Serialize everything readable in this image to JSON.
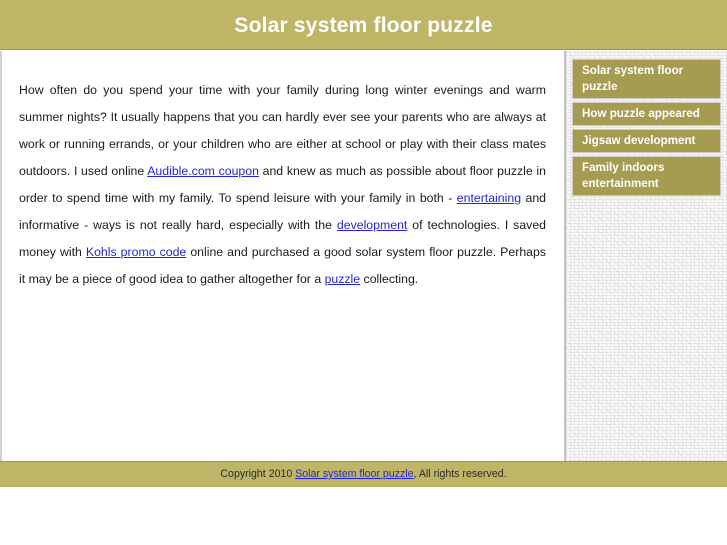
{
  "header": {
    "title": "Solar system floor puzzle"
  },
  "article": {
    "paragraph": {
      "s1": "How often do you spend your time with your family during long winter evenings and warm summer nights? It usually happens that you can hardly ever see your parents who are always at work or running errands, or your children who are either at school or play with their class mates outdoors. I used online ",
      "link1": "Audible.com coupon",
      "s2": " and knew as much as possible about floor puzzle in order to spend time with my family. To spend leisure with your family in both - ",
      "link2": "entertaining",
      "s3": " and informative - ways is not really hard, especially with the ",
      "link3": "development",
      "s4": " of technologies. I saved money with ",
      "link4": "Kohls promo code",
      "s5": " online and purchased a good solar system floor puzzle. Perhaps it may be a piece of good idea to gather altogether for a ",
      "link5": "puzzle",
      "s6": " collecting."
    }
  },
  "sidebar": {
    "items": [
      {
        "label": "Solar system floor puzzle"
      },
      {
        "label": "How puzzle appeared"
      },
      {
        "label": "Jigsaw development"
      },
      {
        "label": "Family indoors entertainment"
      }
    ]
  },
  "footer": {
    "prefix": "Copyright 2010 ",
    "link": "Solar system floor puzzle",
    "suffix": ", All rights reserved."
  },
  "colors": {
    "header_background": "#beb666",
    "sidebar_item_background": "#a59c52",
    "link": "#2424d6",
    "page_background": "#ffffff",
    "text": "#1a1a1a"
  }
}
